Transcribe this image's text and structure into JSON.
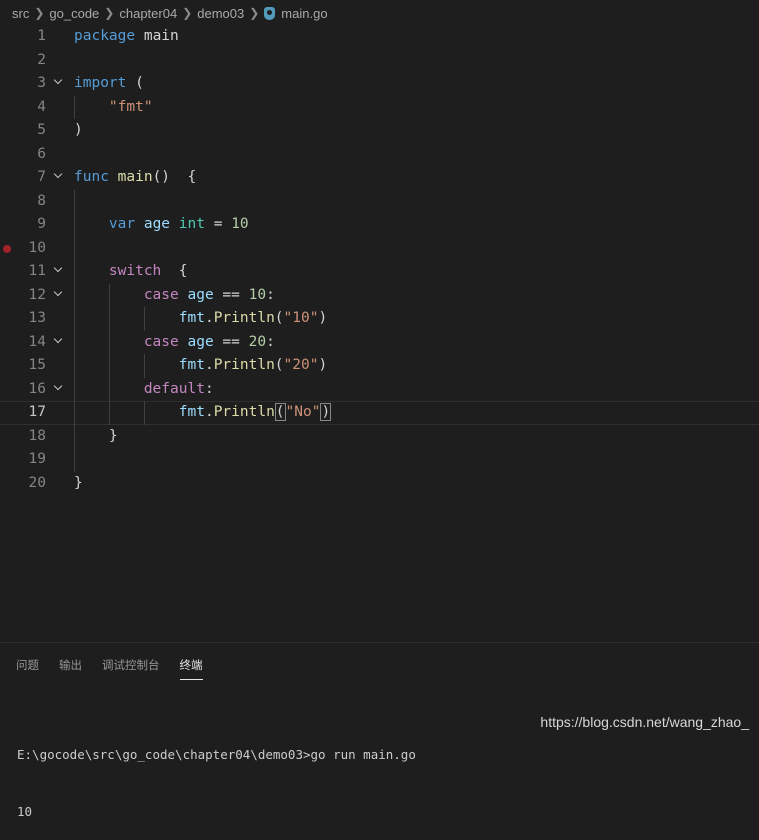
{
  "breadcrumb": {
    "items": [
      "src",
      "go_code",
      "chapter04",
      "demo03"
    ],
    "file": "main.go",
    "file_icon": "go-file-icon"
  },
  "editor": {
    "current_line": 17,
    "breakpoint_line": 10,
    "lines": [
      {
        "n": "1",
        "indent": 0,
        "fold": false,
        "tokens": [
          {
            "t": "package",
            "c": "kw"
          },
          {
            "t": " main",
            "c": ""
          }
        ]
      },
      {
        "n": "2",
        "indent": 0,
        "fold": false,
        "tokens": []
      },
      {
        "n": "3",
        "indent": 0,
        "fold": true,
        "tokens": [
          {
            "t": "import",
            "c": "kw"
          },
          {
            "t": " (",
            "c": ""
          }
        ]
      },
      {
        "n": "4",
        "indent": 1,
        "fold": false,
        "tokens": [
          {
            "t": "\"fmt\"",
            "c": "str"
          }
        ]
      },
      {
        "n": "5",
        "indent": 0,
        "fold": false,
        "tokens": [
          {
            "t": ")",
            "c": ""
          }
        ]
      },
      {
        "n": "6",
        "indent": 0,
        "fold": false,
        "tokens": []
      },
      {
        "n": "7",
        "indent": 0,
        "fold": true,
        "tokens": [
          {
            "t": "func",
            "c": "kw"
          },
          {
            "t": " ",
            "c": ""
          },
          {
            "t": "main",
            "c": "fn"
          },
          {
            "t": "()  {",
            "c": ""
          }
        ]
      },
      {
        "n": "8",
        "indent": 0,
        "fold": false,
        "tokens": []
      },
      {
        "n": "9",
        "indent": 1,
        "fold": false,
        "tokens": [
          {
            "t": "var",
            "c": "kw"
          },
          {
            "t": " ",
            "c": ""
          },
          {
            "t": "age",
            "c": "var"
          },
          {
            "t": " ",
            "c": ""
          },
          {
            "t": "int",
            "c": "ty"
          },
          {
            "t": " = ",
            "c": ""
          },
          {
            "t": "10",
            "c": "num"
          }
        ]
      },
      {
        "n": "10",
        "indent": 0,
        "fold": false,
        "tokens": []
      },
      {
        "n": "11",
        "indent": 1,
        "fold": true,
        "tokens": [
          {
            "t": "switch",
            "c": "ctl"
          },
          {
            "t": "  {",
            "c": ""
          }
        ]
      },
      {
        "n": "12",
        "indent": 2,
        "fold": true,
        "tokens": [
          {
            "t": "case",
            "c": "ctl"
          },
          {
            "t": " ",
            "c": ""
          },
          {
            "t": "age",
            "c": "var"
          },
          {
            "t": " == ",
            "c": ""
          },
          {
            "t": "10",
            "c": "num"
          },
          {
            "t": ":",
            "c": ""
          }
        ]
      },
      {
        "n": "13",
        "indent": 3,
        "fold": false,
        "tokens": [
          {
            "t": "fmt",
            "c": "var"
          },
          {
            "t": ".",
            "c": ""
          },
          {
            "t": "Println",
            "c": "fn"
          },
          {
            "t": "(",
            "c": ""
          },
          {
            "t": "\"10\"",
            "c": "str"
          },
          {
            "t": ")",
            "c": ""
          }
        ]
      },
      {
        "n": "14",
        "indent": 2,
        "fold": true,
        "tokens": [
          {
            "t": "case",
            "c": "ctl"
          },
          {
            "t": " ",
            "c": ""
          },
          {
            "t": "age",
            "c": "var"
          },
          {
            "t": " == ",
            "c": ""
          },
          {
            "t": "20",
            "c": "num"
          },
          {
            "t": ":",
            "c": ""
          }
        ]
      },
      {
        "n": "15",
        "indent": 3,
        "fold": false,
        "tokens": [
          {
            "t": "fmt",
            "c": "var"
          },
          {
            "t": ".",
            "c": ""
          },
          {
            "t": "Println",
            "c": "fn"
          },
          {
            "t": "(",
            "c": ""
          },
          {
            "t": "\"20\"",
            "c": "str"
          },
          {
            "t": ")",
            "c": ""
          }
        ]
      },
      {
        "n": "16",
        "indent": 2,
        "fold": true,
        "tokens": [
          {
            "t": "default",
            "c": "ctl"
          },
          {
            "t": ":",
            "c": ""
          }
        ]
      },
      {
        "n": "17",
        "indent": 3,
        "fold": false,
        "tokens": [
          {
            "t": "fmt",
            "c": "var"
          },
          {
            "t": ".",
            "c": ""
          },
          {
            "t": "Println",
            "c": "fn"
          },
          {
            "t": "(",
            "c": "br1"
          },
          {
            "t": "\"No\"",
            "c": "str"
          },
          {
            "t": ")",
            "c": "br1"
          }
        ]
      },
      {
        "n": "18",
        "indent": 1,
        "fold": false,
        "tokens": [
          {
            "t": "}",
            "c": ""
          }
        ]
      },
      {
        "n": "19",
        "indent": 0,
        "fold": false,
        "tokens": []
      },
      {
        "n": "20",
        "indent": 0,
        "fold": false,
        "tokens": [
          {
            "t": "}",
            "c": ""
          }
        ]
      }
    ]
  },
  "panel": {
    "tabs": [
      {
        "label": "问题",
        "active": false
      },
      {
        "label": "输出",
        "active": false
      },
      {
        "label": "调试控制台",
        "active": false
      },
      {
        "label": "终端",
        "active": true
      }
    ],
    "terminal": {
      "command_line": "E:\\gocode\\src\\go_code\\chapter04\\demo03>go run main.go",
      "output": "10"
    }
  },
  "watermark": "https://blog.csdn.net/wang_zhao_",
  "colors": {
    "background": "#1e1e1e",
    "keyword": "#569cd6",
    "control": "#c586c0",
    "function": "#dcdcaa",
    "string": "#ce9178",
    "number": "#b5cea8",
    "type": "#4ec9b0",
    "variable": "#9cdcfe",
    "breakpoint": "#a4202b"
  }
}
